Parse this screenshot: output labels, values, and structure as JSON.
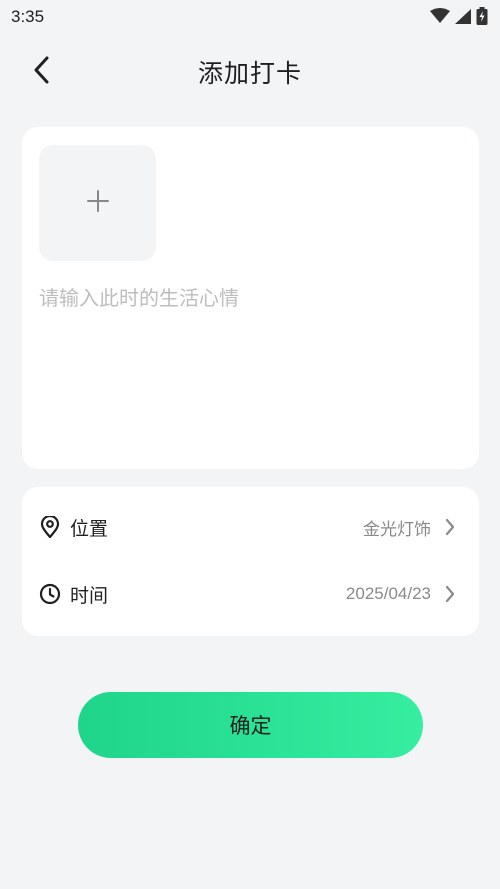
{
  "status_bar": {
    "time": "3:35",
    "icons": [
      "wifi-icon",
      "signal-icon",
      "battery-icon"
    ]
  },
  "header": {
    "title": "添加打卡",
    "back_icon": "chevron-left-icon"
  },
  "note_card": {
    "upload_icon": "plus-icon",
    "placeholder": "请输入此时的生活心情",
    "value": ""
  },
  "info_card": {
    "location": {
      "icon": "location-pin-icon",
      "label": "位置",
      "value": "金光灯饰",
      "chevron": "chevron-right-icon"
    },
    "time": {
      "icon": "clock-icon",
      "label": "时间",
      "value": "2025/04/23",
      "chevron": "chevron-right-icon"
    }
  },
  "confirm_button": {
    "label": "确定"
  },
  "colors": {
    "background": "#f3f4f6",
    "card": "#ffffff",
    "accent_start": "#1ed58a",
    "accent_end": "#35eea0",
    "placeholder": "#bdbdbd",
    "value_text": "#8a8a8a"
  }
}
